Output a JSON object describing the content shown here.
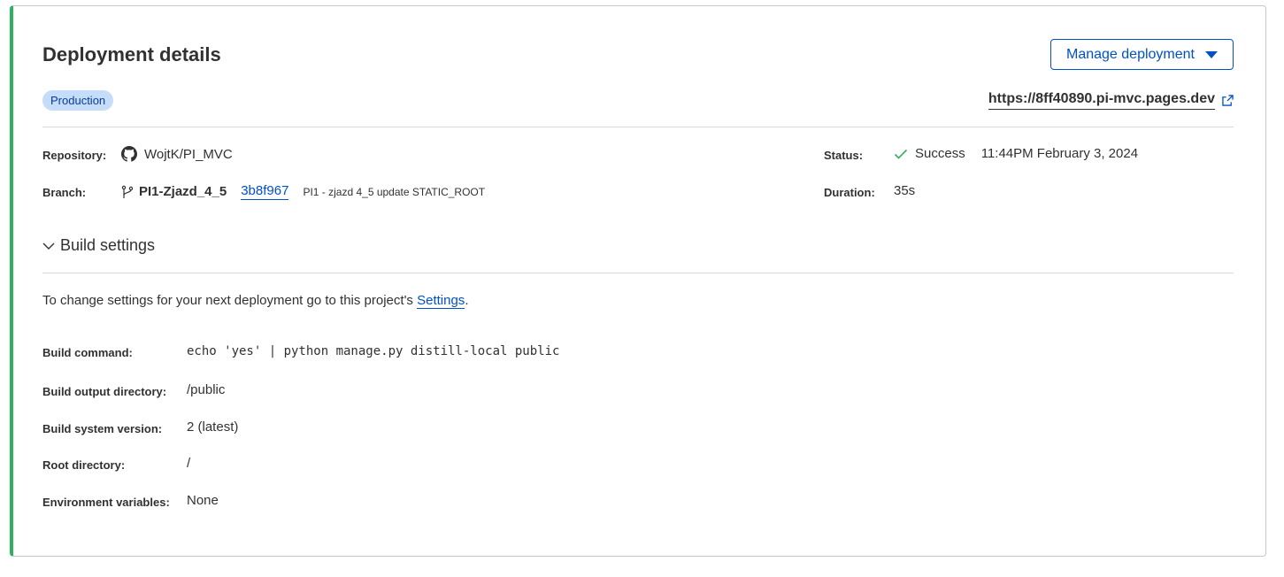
{
  "header": {
    "title": "Deployment details",
    "manage_label": "Manage deployment",
    "badge": "Production",
    "url": "https://8ff40890.pi-mvc.pages.dev"
  },
  "meta": {
    "repository_label": "Repository:",
    "repository": "WojtK/PI_MVC",
    "branch_label": "Branch:",
    "branch": "PI1-Zjazd_4_5",
    "commit": "3b8f967",
    "commit_message": "PI1 - zjazd 4_5 update STATIC_ROOT",
    "status_label": "Status:",
    "status": "Success",
    "timestamp": "11:44PM February 3, 2024",
    "duration_label": "Duration:",
    "duration": "35s"
  },
  "build": {
    "toggle_label": "Build settings",
    "note_prefix": "To change settings for your next deployment go to this project's ",
    "note_link": "Settings",
    "note_suffix": ".",
    "rows": [
      {
        "label": "Build command:",
        "value": "echo 'yes' | python manage.py distill-local public"
      },
      {
        "label": "Build output directory:",
        "value": "/public"
      },
      {
        "label": "Build system version:",
        "value": "2 (latest)"
      },
      {
        "label": "Root directory:",
        "value": "/"
      },
      {
        "label": "Environment variables:",
        "value": "None"
      }
    ]
  },
  "colors": {
    "accent": "#0051c3",
    "success": "#2db35d",
    "badge_bg": "#c5dcfb"
  },
  "icons": {
    "github": "github-icon",
    "branch": "branch-icon",
    "check": "check-icon",
    "external": "external-link-icon",
    "chevron": "chevron-down-icon"
  }
}
